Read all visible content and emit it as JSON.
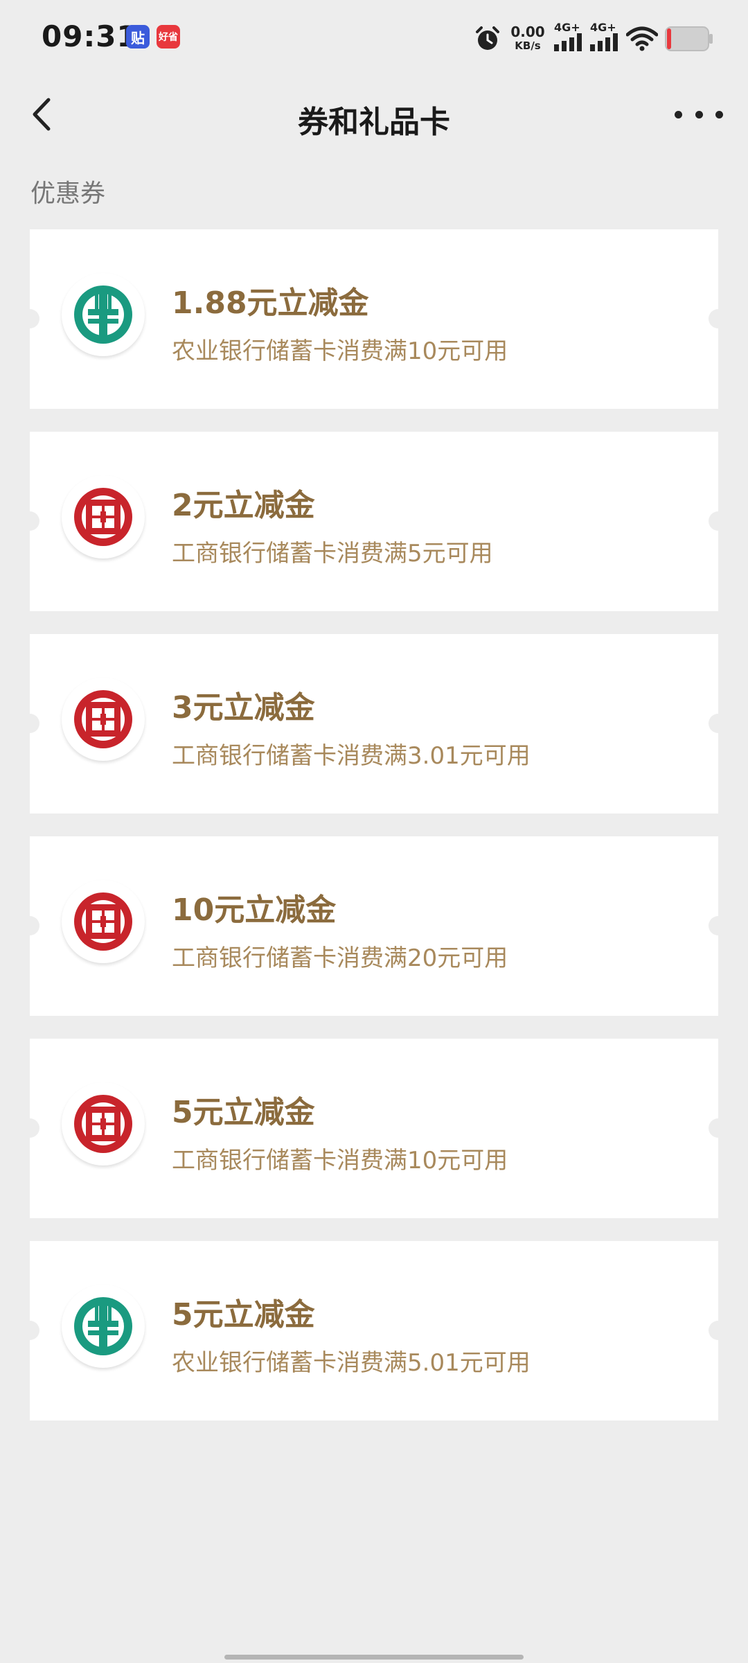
{
  "status_bar": {
    "time": "09:31",
    "badge_1": "贴",
    "badge_2": "好省",
    "speed_value": "0.00",
    "speed_unit": "KB/s",
    "net_1": "4G+",
    "net_2": "4G+",
    "icons": [
      "alarm-icon",
      "signal-icon",
      "signal-icon",
      "wifi-icon",
      "battery-icon"
    ]
  },
  "header": {
    "title": "券和礼品卡"
  },
  "section": {
    "label": "优惠券"
  },
  "colors": {
    "coupon_title": "#8b6b3d",
    "coupon_desc": "#a8895c",
    "abc_green": "#1a9a80",
    "icbc_red": "#c8242b"
  },
  "coupons": [
    {
      "bank": "abc",
      "title": "1.88元立减金",
      "desc": "农业银行储蓄卡消费满10元可用"
    },
    {
      "bank": "icbc",
      "title": "2元立减金",
      "desc": "工商银行储蓄卡消费满5元可用"
    },
    {
      "bank": "icbc",
      "title": "3元立减金",
      "desc": "工商银行储蓄卡消费满3.01元可用"
    },
    {
      "bank": "icbc",
      "title": "10元立减金",
      "desc": "工商银行储蓄卡消费满20元可用"
    },
    {
      "bank": "icbc",
      "title": "5元立减金",
      "desc": "工商银行储蓄卡消费满10元可用"
    },
    {
      "bank": "abc",
      "title": "5元立减金",
      "desc": "农业银行储蓄卡消费满5.01元可用"
    }
  ]
}
